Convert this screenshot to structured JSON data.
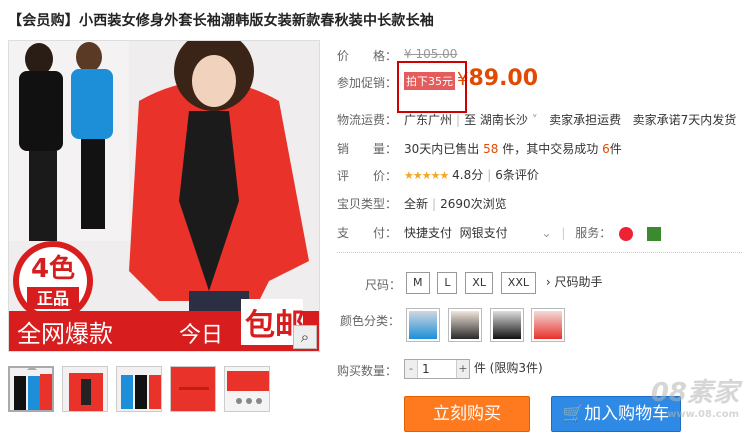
{
  "title": "【会员购】小西装女修身外套长袖潮韩版女装新款春秋装中长款长袖",
  "banner": {
    "badge_big": "4色",
    "badge_small": "正品",
    "left_text": "全网爆款",
    "mid_text": "今日",
    "right_text": "包邮"
  },
  "price": {
    "label": "价　　格：",
    "value": "¥ 105.00"
  },
  "promo": {
    "label": "参加促销：",
    "tag": "拍下35元",
    "yen": "¥",
    "value": "89.00"
  },
  "shipping": {
    "label": "物流运费：",
    "from": "广东广州",
    "to": "至 湖南长沙",
    "note1": "卖家承担运费",
    "note2": "卖家承诺7天内发货"
  },
  "sales": {
    "label": "销　　量：",
    "prefix": "30天内已售出",
    "sold": "58",
    "mid": "件，其中交易成功",
    "success": "6",
    "suffix": "件"
  },
  "rating": {
    "label": "评　　价：",
    "stars": "★★★★★",
    "score": "4.8分",
    "reviews": "6条评价"
  },
  "item_type": {
    "label": "宝贝类型：",
    "condition": "全新",
    "views": "2690次浏览"
  },
  "payment": {
    "label": "支　　付：",
    "method1": "快捷支付",
    "method2": "网银支付",
    "service_label": "服务："
  },
  "size": {
    "label": "尺码：",
    "options": [
      "M",
      "L",
      "XL",
      "XXL"
    ],
    "helper": "尺码助手"
  },
  "color": {
    "label": "颜色分类："
  },
  "quantity": {
    "label": "购买数量：",
    "minus": "-",
    "value": "1",
    "plus": "+",
    "unit": "件",
    "limit": "(限购3件)"
  },
  "buttons": {
    "buy": "立刻购买",
    "cart": "加入购物车"
  },
  "watermark": {
    "main": "08素家",
    "sub": "www.08.com"
  },
  "colors": {
    "accent_orange": "#e14a00",
    "buy_button": "#ff7a1e",
    "cart_button": "#2f8ae5",
    "highlight_box": "#d10000"
  }
}
